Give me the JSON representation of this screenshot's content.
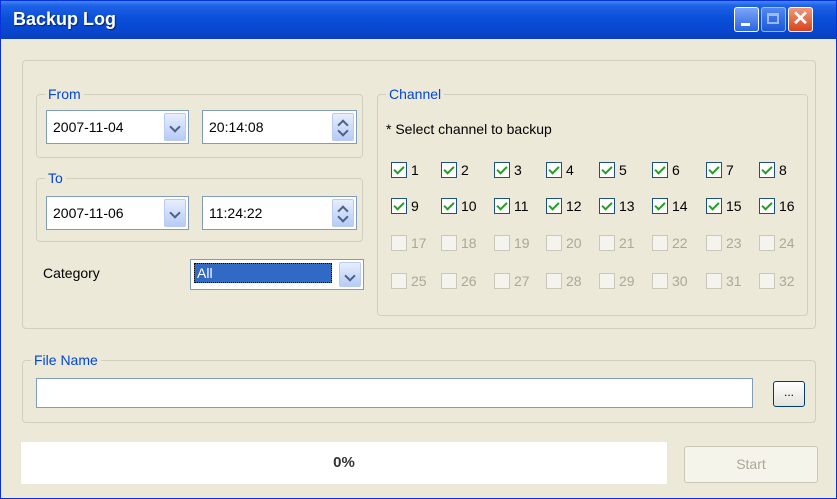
{
  "window": {
    "title": "Backup Log"
  },
  "from": {
    "label": "From",
    "date": "2007-11-04",
    "time": "20:14:08"
  },
  "to": {
    "label": "To",
    "date": "2007-11-06",
    "time": "11:24:22"
  },
  "category": {
    "label": "Category",
    "value": "All"
  },
  "channel": {
    "label": "Channel",
    "hint": "* Select channel to backup",
    "items": [
      {
        "n": "1",
        "on": true
      },
      {
        "n": "2",
        "on": true
      },
      {
        "n": "3",
        "on": true
      },
      {
        "n": "4",
        "on": true
      },
      {
        "n": "5",
        "on": true
      },
      {
        "n": "6",
        "on": true
      },
      {
        "n": "7",
        "on": true
      },
      {
        "n": "8",
        "on": true
      },
      {
        "n": "9",
        "on": true
      },
      {
        "n": "10",
        "on": true
      },
      {
        "n": "11",
        "on": true
      },
      {
        "n": "12",
        "on": true
      },
      {
        "n": "13",
        "on": true
      },
      {
        "n": "14",
        "on": true
      },
      {
        "n": "15",
        "on": true
      },
      {
        "n": "16",
        "on": true
      },
      {
        "n": "17",
        "on": false
      },
      {
        "n": "18",
        "on": false
      },
      {
        "n": "19",
        "on": false
      },
      {
        "n": "20",
        "on": false
      },
      {
        "n": "21",
        "on": false
      },
      {
        "n": "22",
        "on": false
      },
      {
        "n": "23",
        "on": false
      },
      {
        "n": "24",
        "on": false
      },
      {
        "n": "25",
        "on": false
      },
      {
        "n": "26",
        "on": false
      },
      {
        "n": "27",
        "on": false
      },
      {
        "n": "28",
        "on": false
      },
      {
        "n": "29",
        "on": false
      },
      {
        "n": "30",
        "on": false
      },
      {
        "n": "31",
        "on": false
      },
      {
        "n": "32",
        "on": false
      }
    ]
  },
  "file": {
    "label": "File Name",
    "value": "",
    "browse_label": "..."
  },
  "progress": {
    "text": "0%",
    "value": 0
  },
  "start_label": "Start"
}
